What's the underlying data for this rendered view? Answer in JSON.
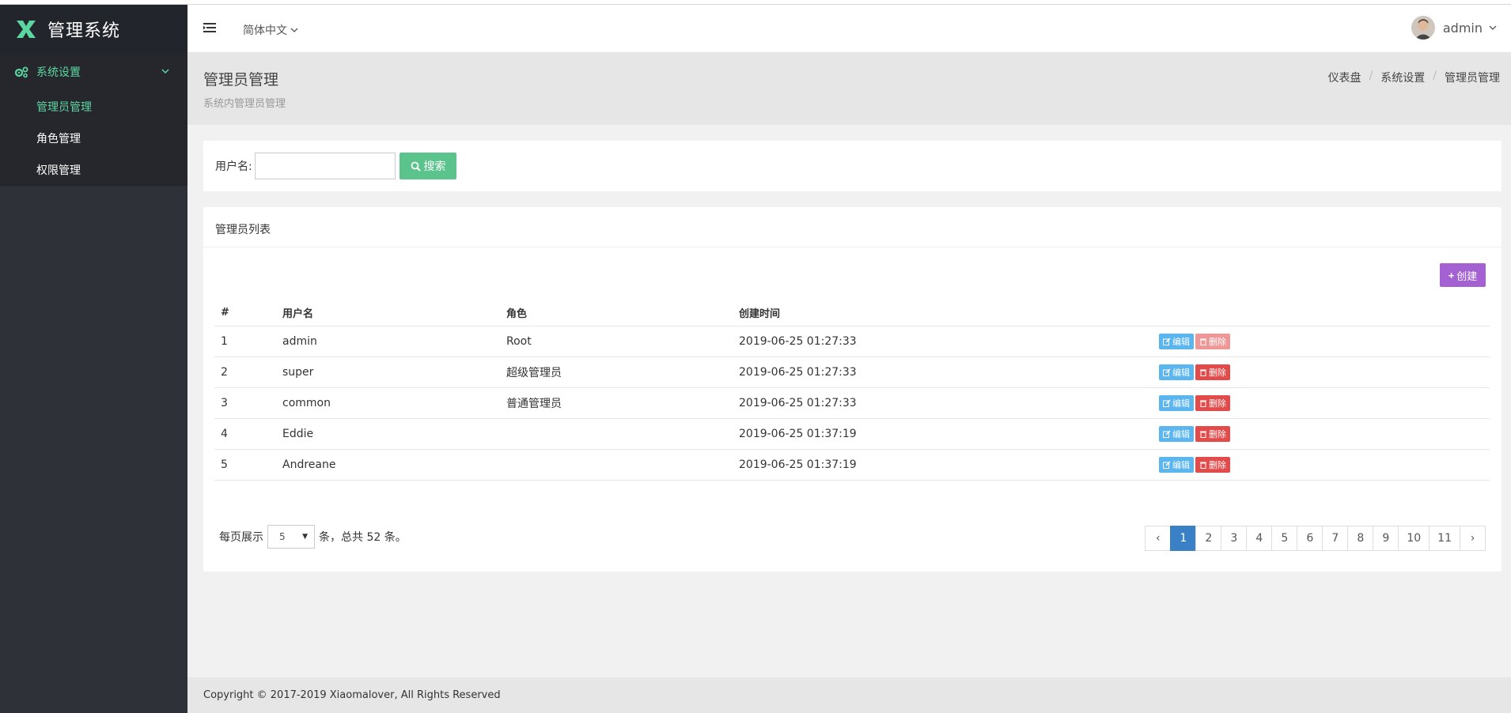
{
  "app": {
    "title": "管理系统"
  },
  "sidebar": {
    "group_label": "系统设置",
    "items": [
      {
        "label": "管理员管理",
        "active": true
      },
      {
        "label": "角色管理"
      },
      {
        "label": "权限管理"
      }
    ]
  },
  "header": {
    "language": "简体中文",
    "username": "admin"
  },
  "page": {
    "title": "管理员管理",
    "subtitle": "系统内管理员管理",
    "breadcrumb": [
      "仪表盘",
      "系统设置",
      "管理员管理"
    ]
  },
  "search": {
    "label": "用户名:",
    "value": "",
    "button": "搜索"
  },
  "list": {
    "title": "管理员列表",
    "create_button": "创建",
    "columns": [
      "#",
      "用户名",
      "角色",
      "创建时间"
    ],
    "rows": [
      {
        "id": "1",
        "username": "admin",
        "role": "Root",
        "created": "2019-06-25 01:27:33",
        "delete_disabled": true
      },
      {
        "id": "2",
        "username": "super",
        "role": "超级管理员",
        "created": "2019-06-25 01:27:33"
      },
      {
        "id": "3",
        "username": "common",
        "role": "普通管理员",
        "created": "2019-06-25 01:27:33"
      },
      {
        "id": "4",
        "username": "Eddie",
        "role": "",
        "created": "2019-06-25 01:37:19"
      },
      {
        "id": "5",
        "username": "Andreane",
        "role": "",
        "created": "2019-06-25 01:37:19"
      }
    ],
    "edit_label": "编辑",
    "delete_label": "删除"
  },
  "pagination": {
    "per_page_prefix": "每页展示",
    "per_page_value": "5",
    "per_page_suffix": "条，总共 52 条。",
    "prev": "‹",
    "next": "›",
    "pages": [
      "1",
      "2",
      "3",
      "4",
      "5",
      "6",
      "7",
      "8",
      "9",
      "10",
      "11"
    ],
    "current": "1"
  },
  "footer": {
    "copyright": "Copyright © 2017-2019 Xiaomalover, All Rights Reserved"
  },
  "colors": {
    "sidebar_bg": "#2f3139",
    "accent_green": "#5cd6a0",
    "search_green": "#5ac48c",
    "create_purple": "#a461d1",
    "edit_blue": "#5bb5ef",
    "delete_red": "#e34a4a",
    "pager_active": "#3a80c6"
  }
}
